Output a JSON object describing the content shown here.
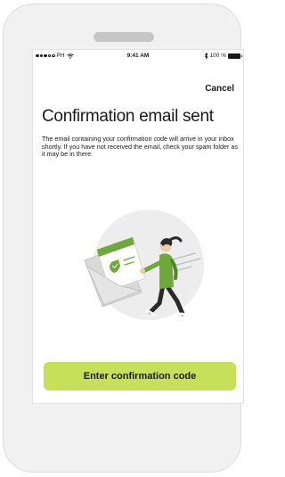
{
  "status_bar": {
    "carrier": "PH",
    "time": "9:41 AM",
    "battery": "100 %",
    "icons": [
      "signal-dots-icon",
      "wifi-icon",
      "bluetooth-icon",
      "battery-icon"
    ]
  },
  "header": {
    "cancel_label": "Cancel"
  },
  "main": {
    "title": "Confirmation email sent",
    "description": "The email containing your confirmation code will arrive in your inbox shortly. If you have not received the email, check your spam folder as it may be in there.",
    "illustration_icon": "person-running-with-envelope-icon"
  },
  "footer": {
    "button_label": "Enter confirmation code"
  },
  "colors": {
    "accent": "#c7e05a",
    "illustration_green": "#6fa83a",
    "illustration_dark": "#2a2a2a",
    "illustration_circle": "#ededed"
  }
}
